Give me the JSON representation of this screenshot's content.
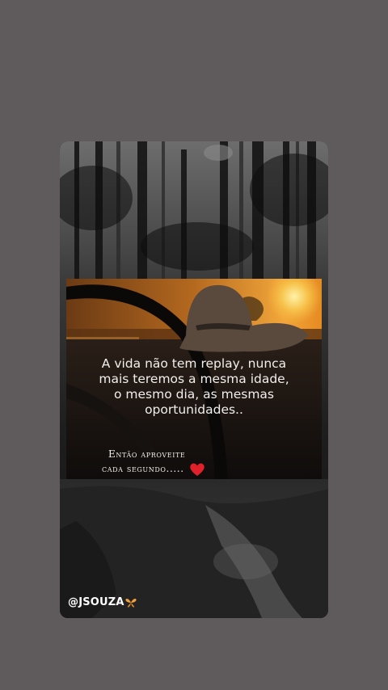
{
  "story": {
    "quote_lines": [
      "A vida não tem replay, nunca",
      "mais teremos a mesma idade,",
      "o mesmo dia, as mesmas",
      "oportunidades.."
    ],
    "caption_line1": "Então aproveite",
    "caption_line2": "cada segundo.....",
    "username": "@JSOUZA",
    "icons": [
      "heart-icon",
      "butterfly-icon"
    ],
    "colors": {
      "heart": "#e0202a",
      "butterfly": "#f2a13a",
      "sun": "#f6b23c"
    }
  }
}
